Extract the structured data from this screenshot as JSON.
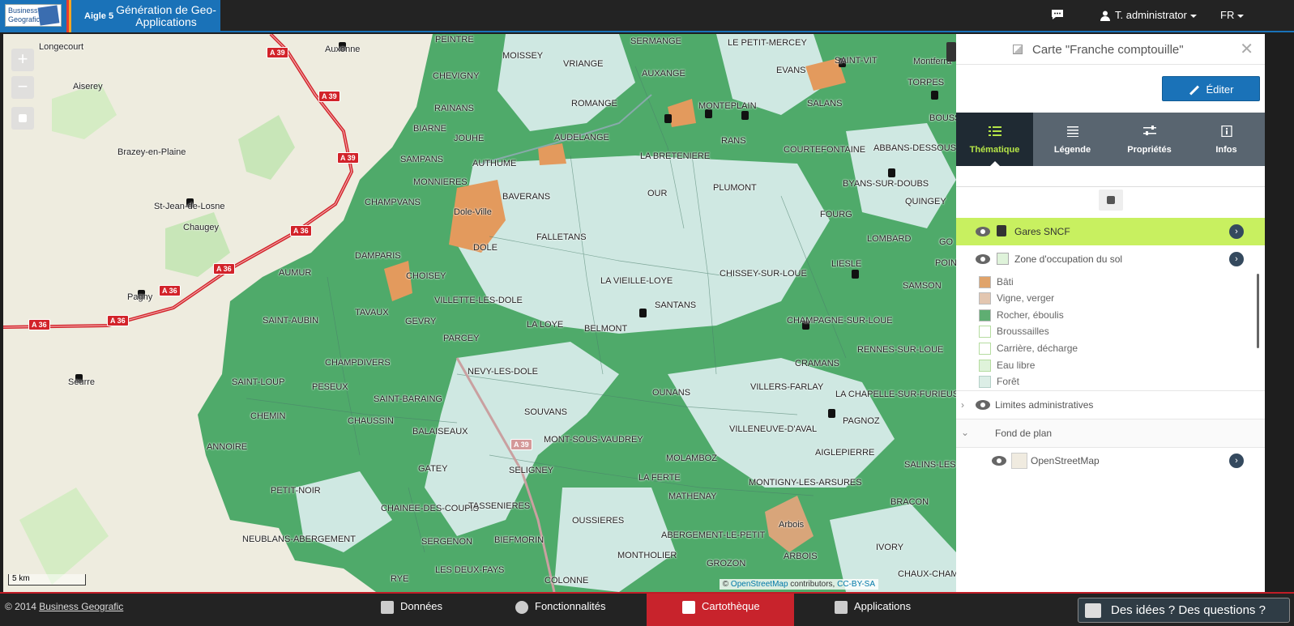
{
  "topbar": {
    "brand_line1": "Business",
    "brand_line2": "Geografic",
    "version": "Aigle 5",
    "title": "Génération de Geo-Applications",
    "chat_icon": "chat-icon",
    "user": "T. administrator",
    "language": "FR"
  },
  "map": {
    "zoom_in": "+",
    "zoom_out": "−",
    "scale": "5 km",
    "attribution_prefix": "© ",
    "attribution_osm": "OpenStreetMap",
    "attribution_mid": " contributors, ",
    "attribution_license": "CC-BY-SA",
    "shields": [
      "A 39",
      "A 39",
      "A 39",
      "A 36",
      "A 36",
      "A 36",
      "A 36",
      "A 36",
      "A 39"
    ],
    "labels": [
      "Longecourt",
      "Auxonne",
      "Aiserey",
      "Brazey-en-Plaine",
      "St-Jean-de-Losne",
      "Chaugey",
      "Pagny",
      "Seurre",
      "PEINTRE",
      "MOISSEY",
      "CHEVIGNY",
      "RAINANS",
      "BIARNE",
      "JOUHE",
      "SAMPANS",
      "MONNIERES",
      "CHAMPVANS",
      "Dole-Ville",
      "DOLE",
      "DAMPARIS",
      "AUMUR",
      "CHOISEY",
      "TAVAUX",
      "SAINT-AUBIN",
      "GEVRY",
      "VILLETTE-LES-DOLE",
      "PARCEY",
      "CHAMPDIVERS",
      "SAINT-LOUP",
      "PESEUX",
      "SAINT-BARAING",
      "CHEMIN",
      "CHAUSSIN",
      "ANNOIRE",
      "BALAISEAUX",
      "PETIT-NOIR",
      "GATEY",
      "CHAINEE-DES-COUPIS",
      "NEUBLANS-ABERGEMENT",
      "SERGENON",
      "LES DEUX-FAYS",
      "RYE",
      "NEVY-LES-DOLE",
      "SOUVANS",
      "TASSENIERES",
      "BIEFMORIN",
      "OUSSIERES",
      "COLONNE",
      "SELIGNEY",
      "MONT-SOUS-VAUDREY",
      "VRIANGE",
      "SERMANGE",
      "AUXANGE",
      "ROMANGE",
      "AUDELANGE",
      "AUTHUME",
      "BAVERANS",
      "FALLETANS",
      "LA VIEILLE-LOYE",
      "LA LOYE",
      "BELMONT",
      "SANTANS",
      "OUR",
      "LA BRETENIERE",
      "PLUMONT",
      "CHISSEY-SUR-LOUE",
      "OUNANS",
      "VILLERS-FARLAY",
      "MOLAMBOZ",
      "LA FERTE",
      "MATHENAY",
      "MONTHOLIER",
      "GROZON",
      "ABERGEMENT-LE-PETIT",
      "Arbois",
      "ARBOIS",
      "MONTIGNY-LES-ARSURES",
      "AIGLEPIERRE",
      "VILLENEUVE-D'AVAL",
      "PAGNOZ",
      "CRAMANS",
      "CHAMPAGNE-SUR-LOUE",
      "RENNES-SUR-LOUE",
      "LA CHAPELLE-SUR-FURIEUSE",
      "SALINS-LES",
      "BRACON",
      "IVORY",
      "CHAUX-CHAMPAG",
      "LE PETIT-MERCEY",
      "EVANS",
      "SAINT-VIT",
      "Montferra",
      "TORPES",
      "BOUSS",
      "SALANS",
      "MONTEPLAIN",
      "RANS",
      "COURTEFONTAINE",
      "ABBANS-DESSOUS",
      "BYANS-SUR-DOUBS",
      "QUINGEY",
      "FOURG",
      "LOMBARD",
      "GO",
      "POINT",
      "LIESLE",
      "SAMSON"
    ]
  },
  "panel": {
    "title": "Carte \"Franche comptouille\"",
    "close": "✕",
    "edit_label": "Éditer",
    "tabs": [
      {
        "label": "Thématique",
        "icon": "list-icon"
      },
      {
        "label": "Légende",
        "icon": "lines-icon"
      },
      {
        "label": "Propriétés",
        "icon": "sliders-icon"
      },
      {
        "label": "Infos",
        "icon": "info-icon"
      }
    ],
    "layers": {
      "gares": "Gares SNCF",
      "zone": "Zone d'occupation du sol",
      "limites": "Limites administratives",
      "fond": "Fond de plan",
      "osm": "OpenStreetMap"
    },
    "legend": [
      {
        "label": "Bâti",
        "color": "#e0a36a"
      },
      {
        "label": "Vigne, verger",
        "color": "#e3c6b0"
      },
      {
        "label": "Rocher, éboulis",
        "color": "#5fae72"
      },
      {
        "label": "Broussailles",
        "color": "#ffffff"
      },
      {
        "label": "Carrière, décharge",
        "color": "#ffffff"
      },
      {
        "label": "Eau libre",
        "color": "#dff3da"
      },
      {
        "label": "Forêt",
        "color": "#dceee6"
      }
    ]
  },
  "bottombar": {
    "copyright_prefix": "© 2014 ",
    "copyright_link": "Business Geografic",
    "nav": [
      "Données",
      "Fonctionnalités",
      "Cartothèque",
      "Applications"
    ],
    "active_nav": "Cartothèque",
    "feedback": "Des idées ? Des questions ?"
  },
  "colors": {
    "accent": "#1a72b8",
    "active_tab_text": "#b6e547",
    "highlight_row": "#c8f060",
    "active_nav": "#c8232c",
    "map_green": "#4faa6a",
    "map_lightblue": "#cfe8e2"
  }
}
